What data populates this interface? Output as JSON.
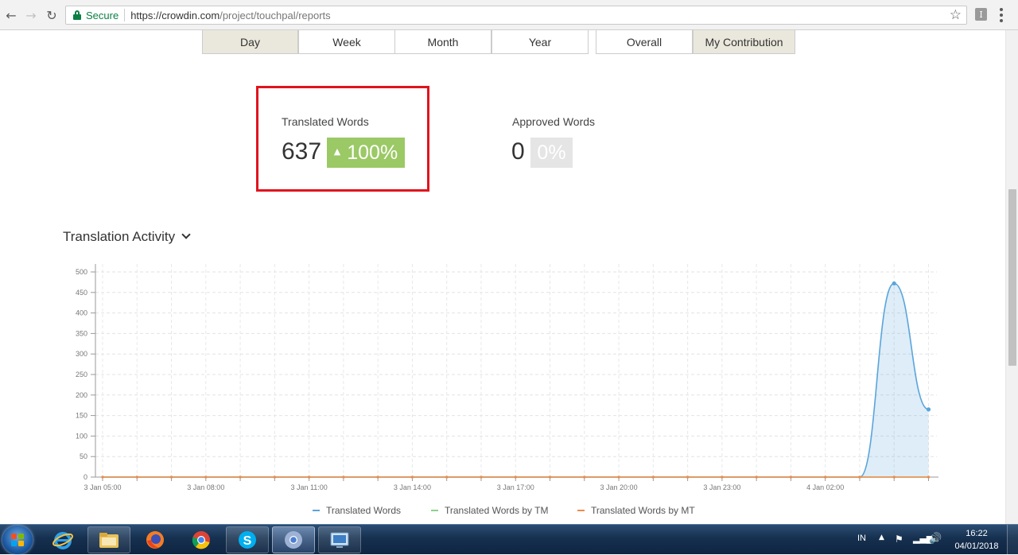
{
  "browser": {
    "secure_label": "Secure",
    "url_host": "https://crowdin.com",
    "url_path": "/project/touchpal/reports",
    "back_icon": "←",
    "forward_icon": "→",
    "reload_icon": "↻",
    "star_icon": "☆",
    "extension_label": "I"
  },
  "period_tabs": [
    {
      "label": "Day",
      "active": true
    },
    {
      "label": "Week",
      "active": false
    },
    {
      "label": "Month",
      "active": false
    },
    {
      "label": "Year",
      "active": false
    }
  ],
  "scope_tabs": [
    {
      "label": "Overall",
      "active": false
    },
    {
      "label": "My Contribution",
      "active": true
    }
  ],
  "stats": {
    "translated": {
      "label": "Translated Words",
      "value": "637",
      "change": "100%",
      "trend_icon": "▲",
      "badge_color": "#9bc965"
    },
    "approved": {
      "label": "Approved Words",
      "value": "0",
      "change": "0%",
      "badge_color": "#e5e5e5"
    },
    "highlight_color": "#e0141e"
  },
  "activity": {
    "title": "Translation Activity"
  },
  "chart_data": {
    "type": "area",
    "title": "",
    "xlabel": "",
    "ylabel": "",
    "ylim": [
      0,
      510
    ],
    "yticks": [
      0,
      50,
      100,
      150,
      200,
      250,
      300,
      350,
      400,
      450,
      500
    ],
    "xtick_labels": [
      "3 Jan 05:00",
      "3 Jan 08:00",
      "3 Jan 11:00",
      "3 Jan 14:00",
      "3 Jan 17:00",
      "3 Jan 20:00",
      "3 Jan 23:00",
      "4 Jan 02:00"
    ],
    "x_hours": [
      0,
      3,
      6,
      9,
      12,
      15,
      18,
      21
    ],
    "grid": true,
    "legend_position": "bottom",
    "series": [
      {
        "name": "Translated Words",
        "color": "#5aa5da",
        "x": [
          0,
          1,
          2,
          3,
          4,
          5,
          6,
          7,
          8,
          9,
          10,
          11,
          12,
          13,
          14,
          15,
          16,
          17,
          18,
          19,
          20,
          21,
          22,
          23,
          24
        ],
        "values": [
          0,
          0,
          0,
          0,
          0,
          0,
          0,
          0,
          0,
          0,
          0,
          0,
          0,
          0,
          0,
          0,
          0,
          0,
          0,
          0,
          0,
          0,
          0,
          472,
          165
        ]
      },
      {
        "name": "Translated Words by TM",
        "color": "#8ed08b",
        "x": [
          0,
          1,
          2,
          3,
          4,
          5,
          6,
          7,
          8,
          9,
          10,
          11,
          12,
          13,
          14,
          15,
          16,
          17,
          18,
          19,
          20,
          21,
          22,
          23,
          24
        ],
        "values": [
          0,
          0,
          0,
          0,
          0,
          0,
          0,
          0,
          0,
          0,
          0,
          0,
          0,
          0,
          0,
          0,
          0,
          0,
          0,
          0,
          0,
          0,
          0,
          0,
          0
        ]
      },
      {
        "name": "Translated Words by MT",
        "color": "#f08a4b",
        "x": [
          0,
          1,
          2,
          3,
          4,
          5,
          6,
          7,
          8,
          9,
          10,
          11,
          12,
          13,
          14,
          15,
          16,
          17,
          18,
          19,
          20,
          21,
          22,
          23,
          24
        ],
        "values": [
          0,
          0,
          0,
          0,
          0,
          0,
          0,
          0,
          0,
          0,
          0,
          0,
          0,
          0,
          0,
          0,
          0,
          0,
          0,
          0,
          0,
          0,
          0,
          0,
          0
        ]
      }
    ]
  },
  "taskbar": {
    "items": [
      "internet-explorer",
      "file-explorer",
      "firefox",
      "chrome",
      "skype",
      "chromium",
      "remote-desktop"
    ],
    "tray": {
      "language": "IN",
      "time": "16:22",
      "date": "04/01/2018",
      "arrow_icon": "▲",
      "flag_icon": "⚑",
      "signal_icon": "▂▄▆",
      "volume_icon": "🔊"
    }
  }
}
